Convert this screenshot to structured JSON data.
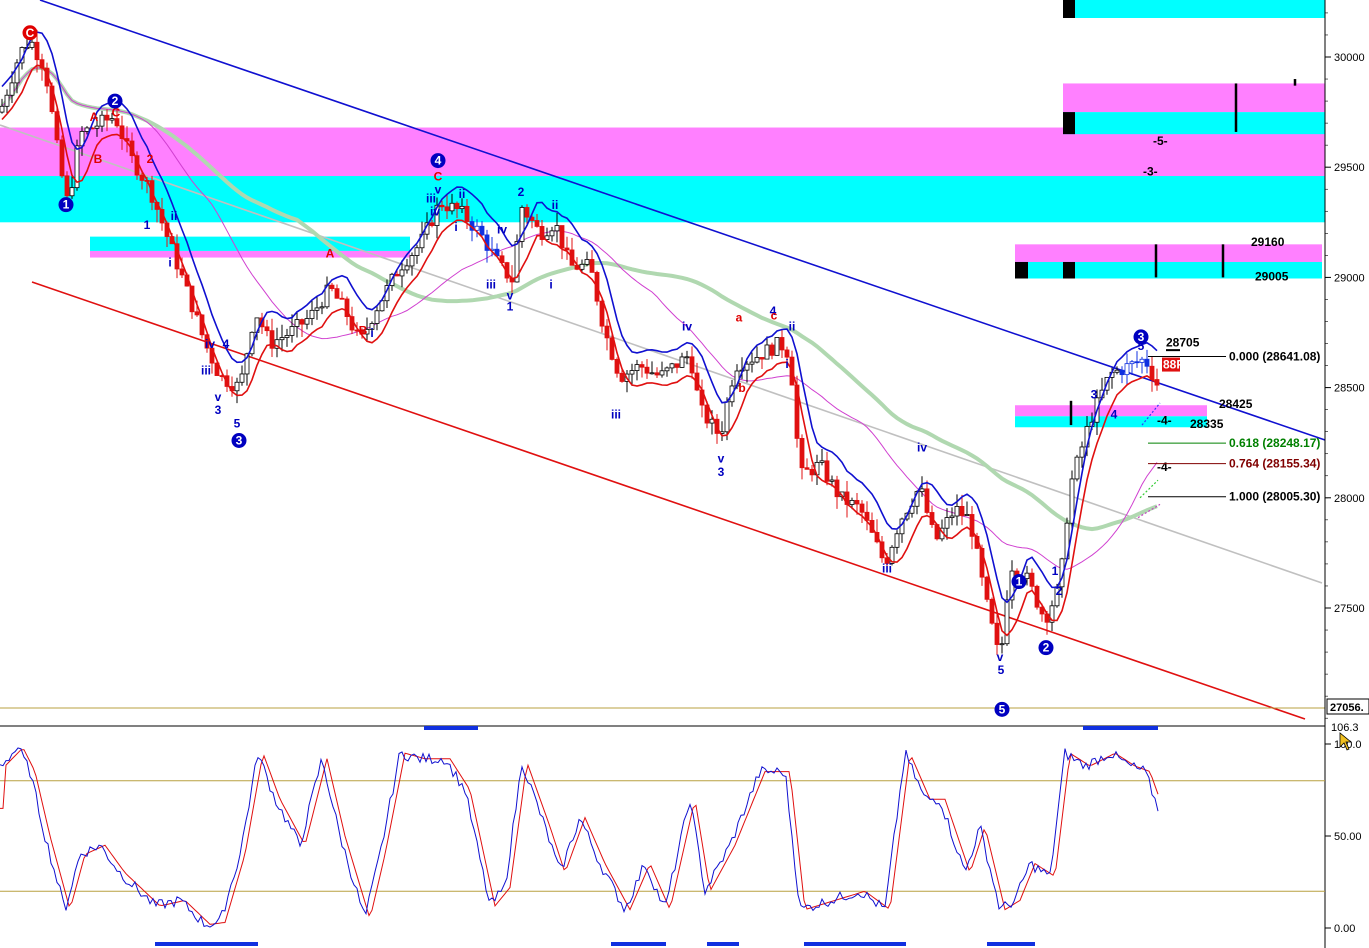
{
  "colors": {
    "cyan": "#00ffff",
    "magenta": "#ff80ff",
    "blue_line": "#1010d0",
    "red_line": "#e01010",
    "ma_green": "#b0d8b0",
    "ma_gray": "#c0c0c0",
    "ma_purple": "#d040d0",
    "wave_blue": "#0000c0",
    "wave_red": "#e00000",
    "fib_green": "#008000",
    "fib_maroon": "#800000",
    "gold": "#b8a040"
  },
  "price_axis": {
    "ticks": [
      "30000",
      "29500",
      "29000",
      "28500",
      "28000",
      "27500"
    ],
    "tick_values": [
      30000,
      29500,
      29000,
      28500,
      28000,
      27500
    ],
    "last_label": "27056.",
    "ylim": [
      27000,
      30270
    ]
  },
  "osc_axis": {
    "ticks": [
      "100.0",
      "50.00",
      "0.00"
    ],
    "tick_values": [
      100,
      50,
      0
    ],
    "top_label": "106.3",
    "ylim": [
      -5,
      106
    ]
  },
  "zone_labels": [
    {
      "text": "29160",
      "price": 29160
    },
    {
      "text": "29005",
      "price": 29005
    },
    {
      "text": "28705",
      "price": 28705
    },
    {
      "text": "28425",
      "price": 28425
    },
    {
      "text": "28335",
      "price": 28335
    },
    {
      "text": "-5-",
      "price": 29620
    },
    {
      "text": "-3-",
      "price": 29480
    },
    {
      "text": "-4-",
      "price": 28350
    },
    {
      "text": "-4-",
      "price": 28140
    }
  ],
  "fib_levels": [
    {
      "text": "0.000  (28641.08)",
      "price": 28641,
      "color": "#000000"
    },
    {
      "text": "0.618  (28248.17)",
      "price": 28248,
      "color": "#008000"
    },
    {
      "text": "0.764  (28155.34)",
      "price": 28155,
      "color": "#800000"
    },
    {
      "text": "1.000  (28005.30)",
      "price": 28005,
      "color": "#000000"
    }
  ],
  "pti_label": "88PTI",
  "waves_blue": [
    {
      "t": "1",
      "x": 147,
      "p": 29220
    },
    {
      "t": "ii",
      "x": 174,
      "p": 29260
    },
    {
      "t": "i",
      "x": 170,
      "p": 29050
    },
    {
      "t": "iv",
      "x": 210,
      "p": 28680
    },
    {
      "t": "4",
      "x": 226,
      "p": 28680
    },
    {
      "t": "iii",
      "x": 206,
      "p": 28560
    },
    {
      "t": "v",
      "x": 218,
      "p": 28440
    },
    {
      "t": "3",
      "x": 218,
      "p": 28380
    },
    {
      "t": "5",
      "x": 237,
      "p": 28320
    },
    {
      "t": "i",
      "x": 372,
      "p": 28730
    },
    {
      "t": "v",
      "x": 438,
      "p": 29380
    },
    {
      "t": "iii",
      "x": 431,
      "p": 29340
    },
    {
      "t": "iv",
      "x": 435,
      "p": 29280
    },
    {
      "t": "ii",
      "x": 462,
      "p": 29360
    },
    {
      "t": "i",
      "x": 456,
      "p": 29210
    },
    {
      "t": "iv",
      "x": 502,
      "p": 29200
    },
    {
      "t": "iii",
      "x": 491,
      "p": 28950
    },
    {
      "t": "v",
      "x": 510,
      "p": 28900
    },
    {
      "t": "1",
      "x": 510,
      "p": 28850
    },
    {
      "t": "2",
      "x": 521,
      "p": 29370
    },
    {
      "t": "ii",
      "x": 555,
      "p": 29310
    },
    {
      "t": "i",
      "x": 551,
      "p": 28950
    },
    {
      "t": "iii",
      "x": 616,
      "p": 28360
    },
    {
      "t": "iv",
      "x": 687,
      "p": 28760
    },
    {
      "t": "4",
      "x": 773,
      "p": 28830
    },
    {
      "t": "ii",
      "x": 792,
      "p": 28760
    },
    {
      "t": "i",
      "x": 787,
      "p": 28590
    },
    {
      "t": "v",
      "x": 721,
      "p": 28160
    },
    {
      "t": "3",
      "x": 721,
      "p": 28100
    },
    {
      "t": "iv",
      "x": 922,
      "p": 28210
    },
    {
      "t": "iii",
      "x": 887,
      "p": 27660
    },
    {
      "t": "v",
      "x": 1000,
      "p": 27260
    },
    {
      "t": "5",
      "x": 1001,
      "p": 27200
    },
    {
      "t": "1",
      "x": 1055,
      "p": 27650
    },
    {
      "t": "2",
      "x": 1059,
      "p": 27560
    },
    {
      "t": "3",
      "x": 1094,
      "p": 28450
    },
    {
      "t": "4",
      "x": 1114,
      "p": 28360
    },
    {
      "t": "5",
      "x": 1141,
      "p": 28670
    }
  ],
  "waves_red": [
    {
      "t": "A",
      "x": 94,
      "p": 29710
    },
    {
      "t": "C",
      "x": 116,
      "p": 29730
    },
    {
      "t": "B",
      "x": 98,
      "p": 29520
    },
    {
      "t": "2",
      "x": 150,
      "p": 29520
    },
    {
      "t": "A",
      "x": 330,
      "p": 29090
    },
    {
      "t": "B",
      "x": 363,
      "p": 28740
    },
    {
      "t": "C",
      "x": 438,
      "p": 29440
    },
    {
      "t": "a",
      "x": 739,
      "p": 28800
    },
    {
      "t": "c",
      "x": 774,
      "p": 28810
    },
    {
      "t": "b",
      "x": 742,
      "p": 28480
    }
  ],
  "circles": [
    {
      "t": "C",
      "x": 30,
      "p": 30110,
      "color": "#e00000"
    },
    {
      "t": "2",
      "x": 115,
      "p": 29800,
      "color": "#0000c0"
    },
    {
      "t": "1",
      "x": 66,
      "p": 29330,
      "color": "#0000c0"
    },
    {
      "t": "3",
      "x": 239,
      "p": 28260,
      "color": "#0000c0"
    },
    {
      "t": "4",
      "x": 438,
      "p": 29530,
      "color": "#0000c0"
    },
    {
      "t": "1",
      "x": 1019,
      "p": 27620,
      "color": "#0000c0"
    },
    {
      "t": "2",
      "x": 1046,
      "p": 27320,
      "color": "#0000c0"
    },
    {
      "t": "5",
      "x": 1002,
      "p": 27040,
      "color": "#0000c0"
    },
    {
      "t": "3",
      "x": 1141,
      "p": 28730,
      "color": "#0000c0"
    }
  ],
  "chart_data": {
    "type": "candlestick",
    "ylim": [
      27000,
      30270
    ],
    "bars": 230,
    "key_prices": [
      {
        "label": "C",
        "price": 30050
      },
      {
        "label": "1",
        "price": 29320
      },
      {
        "label": "2",
        "price": 29750
      },
      {
        "label": "3",
        "price": 28380
      },
      {
        "label": "4",
        "price": 29350
      },
      {
        "label": "iii",
        "price": 28500
      },
      {
        "label": "3",
        "price": 28250
      },
      {
        "label": "iii",
        "price": 27650
      },
      {
        "label": "5",
        "price": 27200
      },
      {
        "label": "1",
        "price": 27700
      },
      {
        "label": "2",
        "price": 27450
      },
      {
        "label": "3",
        "price": 28620
      }
    ],
    "oscillator": {
      "type": "line",
      "ylim": [
        -5,
        106
      ],
      "levels": [
        80,
        20
      ]
    }
  }
}
